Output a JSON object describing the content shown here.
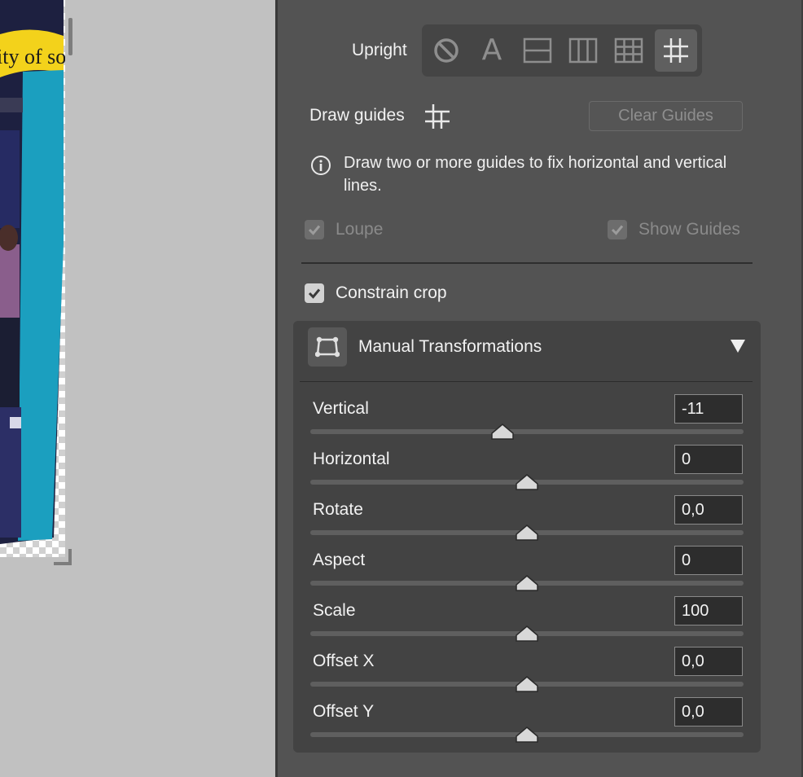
{
  "canvas": {
    "photo_sign_text": "ity of sol"
  },
  "upright": {
    "label": "Upright",
    "buttons": [
      {
        "name": "off",
        "icon": "prohibited-icon",
        "glyph": ""
      },
      {
        "name": "auto",
        "icon": "letter-a-icon",
        "glyph": "A"
      },
      {
        "name": "level",
        "icon": "level-icon",
        "glyph": ""
      },
      {
        "name": "vertical",
        "icon": "vertical-icon",
        "glyph": ""
      },
      {
        "name": "full",
        "icon": "grid-icon",
        "glyph": ""
      },
      {
        "name": "guided",
        "icon": "guides-icon",
        "glyph": ""
      }
    ],
    "active": "guided"
  },
  "guides": {
    "draw_label": "Draw guides",
    "clear_label": "Clear Guides",
    "info": "Draw two or more guides to fix horizontal and vertical lines."
  },
  "options": {
    "loupe": {
      "label": "Loupe",
      "checked": true,
      "enabled": false
    },
    "show_guides": {
      "label": "Show Guides",
      "checked": true,
      "enabled": false
    },
    "constrain_crop": {
      "label": "Constrain crop",
      "checked": true,
      "enabled": true
    }
  },
  "manual": {
    "title": "Manual Transformations",
    "sliders": [
      {
        "label": "Vertical",
        "value": "-11",
        "position": 0.443
      },
      {
        "label": "Horizontal",
        "value": "0",
        "position": 0.5
      },
      {
        "label": "Rotate",
        "value": "0,0",
        "position": 0.5
      },
      {
        "label": "Aspect",
        "value": "0",
        "position": 0.5
      },
      {
        "label": "Scale",
        "value": "100",
        "position": 0.5
      },
      {
        "label": "Offset X",
        "value": "0,0",
        "position": 0.5
      },
      {
        "label": "Offset Y",
        "value": "0,0",
        "position": 0.5
      }
    ]
  },
  "colors": {
    "panel": "#535353",
    "control_bg": "#454545",
    "accent_thumb": "#d8d8d8"
  }
}
